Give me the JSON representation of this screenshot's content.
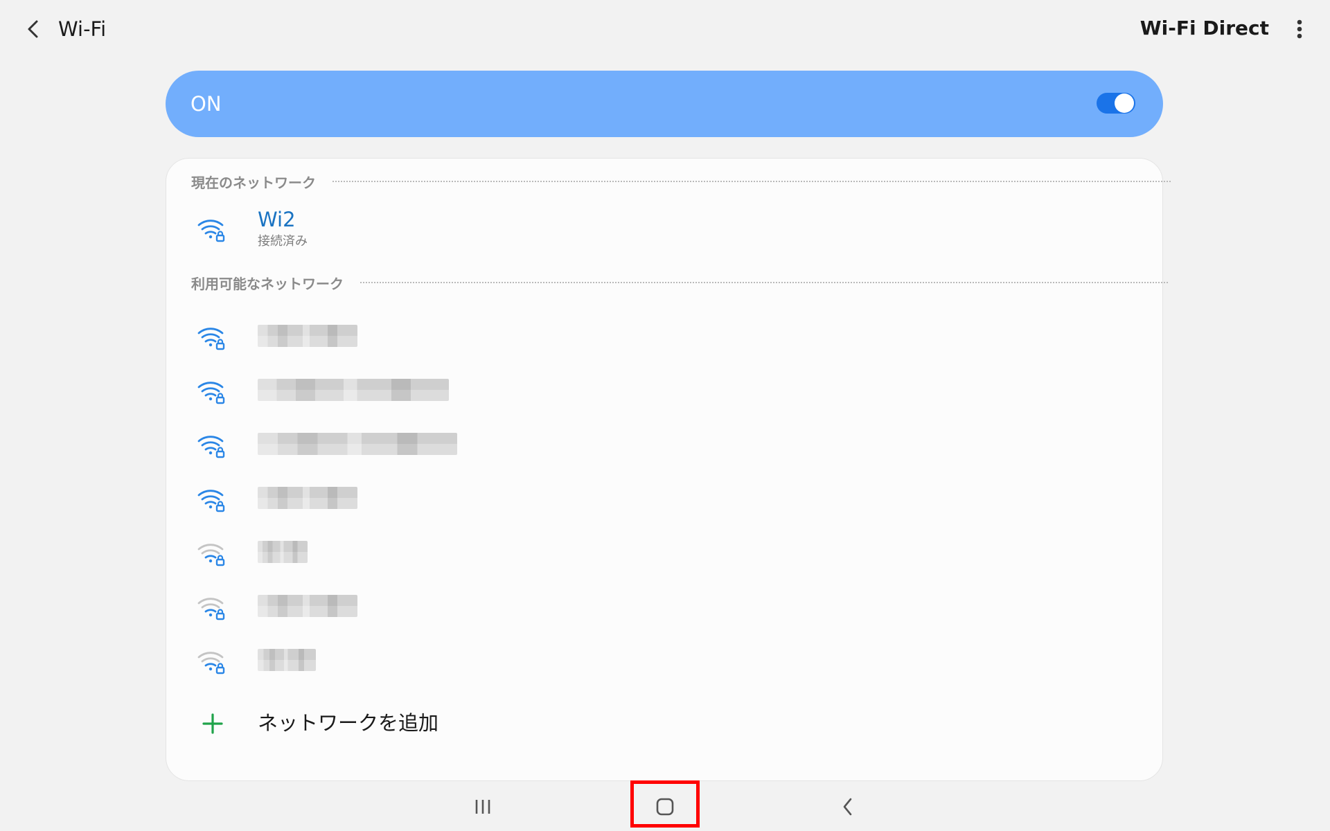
{
  "header": {
    "title": "Wi-Fi",
    "wifi_direct_label": "Wi-Fi Direct",
    "back_icon": "chevron-left-icon",
    "more_icon": "more-vertical-icon"
  },
  "master_switch": {
    "label": "ON",
    "state": true,
    "color": "#72aefc",
    "toggle_color": "#1a73e8"
  },
  "current_network": {
    "section_label": "現在のネットワーク",
    "name": "Wi2",
    "status": "接続済み",
    "secured": true,
    "signal": "strong",
    "name_color": "#1a73c2"
  },
  "available_networks": {
    "section_label": "利用可能なネットワーク",
    "items": [
      {
        "name_visible": false,
        "secured": true,
        "signal": "strong"
      },
      {
        "name_visible": false,
        "secured": true,
        "signal": "strong"
      },
      {
        "name_visible": false,
        "secured": true,
        "signal": "strong"
      },
      {
        "name_visible": false,
        "secured": true,
        "signal": "strong"
      },
      {
        "name_visible": false,
        "secured": true,
        "signal": "weak"
      },
      {
        "name_visible": false,
        "secured": true,
        "signal": "weak"
      },
      {
        "name_visible": false,
        "secured": true,
        "signal": "weak"
      }
    ]
  },
  "add_network": {
    "label": "ネットワークを追加",
    "icon": "plus-icon",
    "icon_color": "#1fa34a"
  },
  "navigation_bar": {
    "recents_icon": "recents-icon",
    "home_icon": "home-icon",
    "back_icon": "back-icon",
    "highlighted": "home",
    "highlight_color": "#ff0000"
  }
}
